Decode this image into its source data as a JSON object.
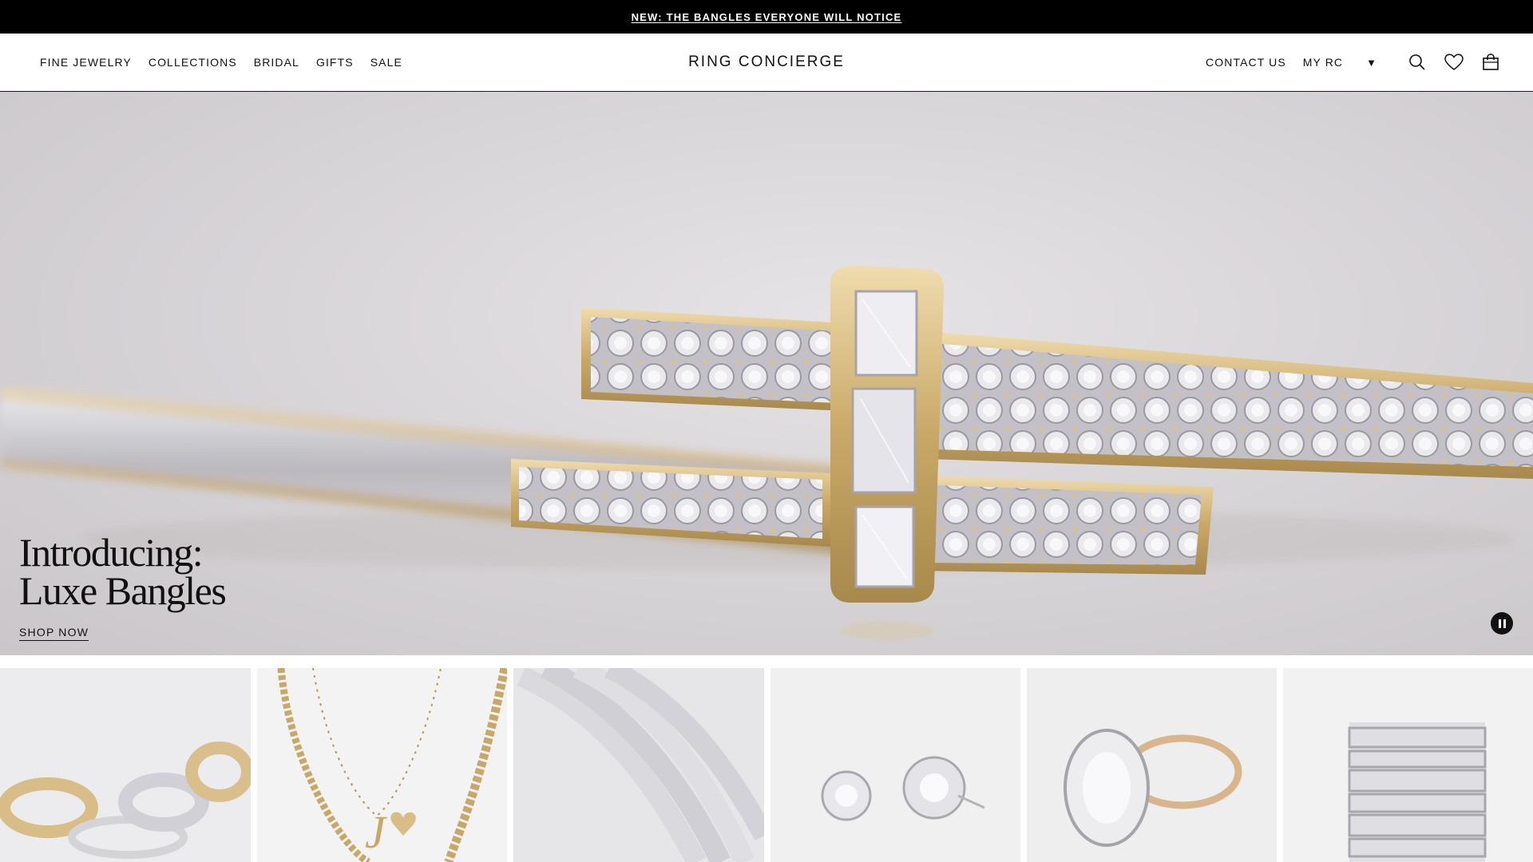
{
  "announcement": {
    "text": "NEW: THE BANGLES EVERYONE WILL NOTICE"
  },
  "nav": {
    "left": [
      "FINE JEWELRY",
      "COLLECTIONS",
      "BRIDAL",
      "GIFTS",
      "SALE"
    ],
    "logo": "RING CONCIERGE",
    "contact": "CONTACT US",
    "account": "MY RC"
  },
  "icons": {
    "search": "search-icon",
    "wishlist": "heart-icon",
    "cart": "shopping-bag-icon",
    "account_caret": "caret-down-icon",
    "pause": "pause-icon"
  },
  "hero": {
    "title": "Introducing:\nLuxe Bangles",
    "cta": "SHOP NOW"
  },
  "tiles": [
    "stacked-rings-image",
    "gold-necklaces-image",
    "tennis-bracelets-image",
    "diamond-stud-earrings-image",
    "oval-engagement-ring-image",
    "eternity-band-stack-image"
  ],
  "colors": {
    "announcement_bg": "#000000",
    "hero_bg": "#d6d3d7",
    "gold": "#d8bd86"
  }
}
